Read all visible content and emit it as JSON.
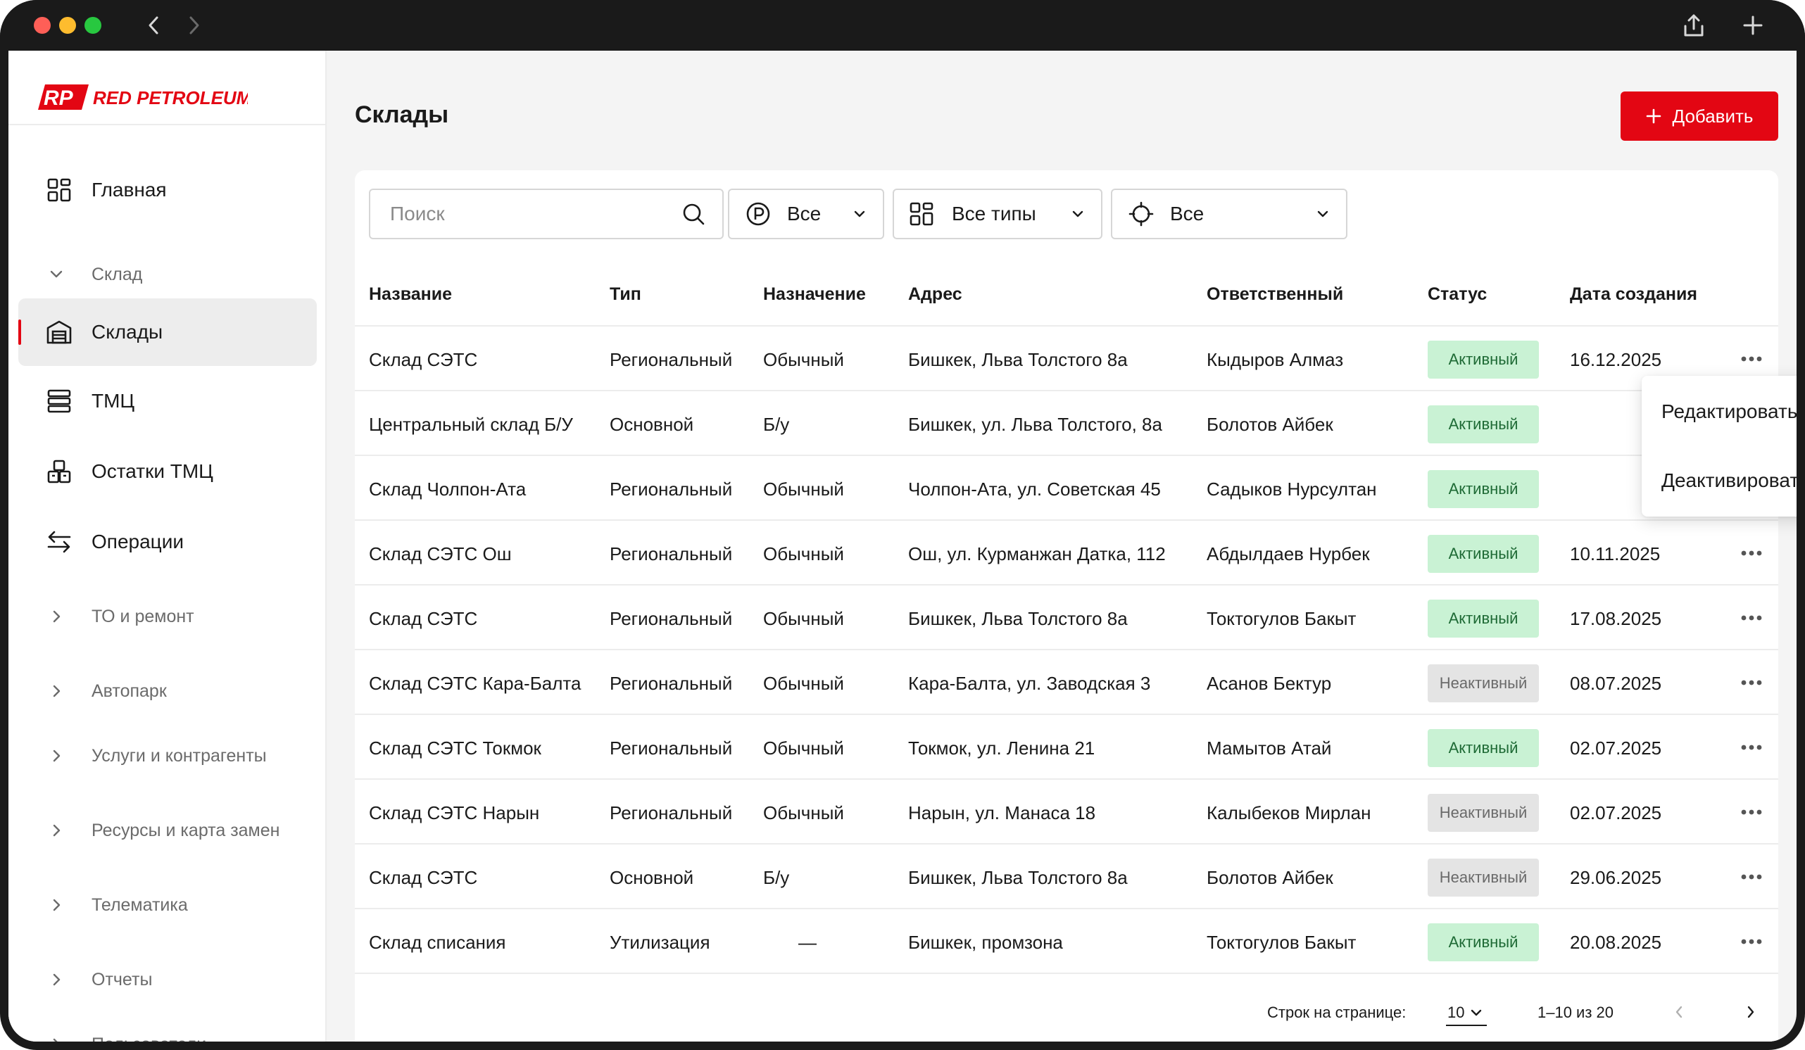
{
  "brand": {
    "logo_mark": "RP",
    "logo_text": "RED PETROLEUM",
    "accent_color": "#e30613"
  },
  "sidebar": {
    "home": "Главная",
    "warehouse_group": "Склад",
    "items": [
      {
        "label": "Склады",
        "icon": "warehouse-icon",
        "active": true
      },
      {
        "label": "ТМЦ",
        "icon": "stack-icon",
        "active": false
      },
      {
        "label": "Остатки ТМЦ",
        "icon": "boxes-icon",
        "active": false
      },
      {
        "label": "Операции",
        "icon": "swap-icon",
        "active": false
      }
    ],
    "groups": [
      "ТО и ремонт",
      "Автопарк",
      "Услуги и контрагенты",
      "Ресурсы и карта замен",
      "Телематика",
      "Отчеты",
      "Пользователи"
    ]
  },
  "header": {
    "title": "Склады",
    "add_button": "Добавить"
  },
  "filters": {
    "search_placeholder": "Поиск",
    "purpose": "Все",
    "type": "Все типы",
    "location": "Все"
  },
  "table": {
    "columns": [
      "Название",
      "Тип",
      "Назначение",
      "Адрес",
      "Ответственный",
      "Статус",
      "Дата создания"
    ],
    "rows": [
      {
        "name": "Склад СЭТС",
        "type": "Региональный",
        "purpose": "Обычный",
        "address": "Бишкек, Льва Толстого 8а",
        "owner": "Кыдыров Алмаз",
        "status": "Активный",
        "active": true,
        "date": "16.12.2025"
      },
      {
        "name": "Центральный склад Б/У",
        "type": "Основной",
        "purpose": "Б/у",
        "address": "Бишкек, ул. Льва Толстого, 8а",
        "owner": "Болотов Айбек",
        "status": "Активный",
        "active": true,
        "date": ""
      },
      {
        "name": "Склад Чолпон-Ата",
        "type": "Региональный",
        "purpose": "Обычный",
        "address": "Чолпон-Ата, ул. Советская 45",
        "owner": "Садыков Нурсултан",
        "status": "Активный",
        "active": true,
        "date": ""
      },
      {
        "name": "Склад СЭТС Ош",
        "type": "Региональный",
        "purpose": "Обычный",
        "address": "Ош, ул. Курманжан Датка, 112",
        "owner": "Абдылдаев Нурбек",
        "status": "Активный",
        "active": true,
        "date": "10.11.2025"
      },
      {
        "name": "Склад СЭТС",
        "type": "Региональный",
        "purpose": "Обычный",
        "address": "Бишкек, Льва Толстого 8а",
        "owner": "Токтогулов Бакыт",
        "status": "Активный",
        "active": true,
        "date": "17.08.2025"
      },
      {
        "name": "Склад СЭТС Кара-Балта",
        "type": "Региональный",
        "purpose": "Обычный",
        "address": "Кара-Балта, ул. Заводская 3",
        "owner": "Асанов Бектур",
        "status": "Неактивный",
        "active": false,
        "date": "08.07.2025"
      },
      {
        "name": "Склад СЭТС Токмок",
        "type": "Региональный",
        "purpose": "Обычный",
        "address": "Токмок, ул. Ленина 21",
        "owner": "Мамытов Атай",
        "status": "Активный",
        "active": true,
        "date": "02.07.2025"
      },
      {
        "name": "Склад СЭТС Нарын",
        "type": "Региональный",
        "purpose": "Обычный",
        "address": "Нарын, ул. Манаса 18",
        "owner": "Калыбеков Мирлан",
        "status": "Неактивный",
        "active": false,
        "date": "02.07.2025"
      },
      {
        "name": "Склад СЭТС",
        "type": "Основной",
        "purpose": "Б/у",
        "address": "Бишкек, Льва Толстого 8а",
        "owner": "Болотов Айбек",
        "status": "Неактивный",
        "active": false,
        "date": "29.06.2025"
      },
      {
        "name": "Склад списания",
        "type": "Утилизация",
        "purpose": "—",
        "address": "Бишкек, промзона",
        "owner": "Токтогулов Бакыт",
        "status": "Активный",
        "active": true,
        "date": "20.08.2025"
      }
    ]
  },
  "context_menu": {
    "edit": "Редактировать",
    "deactivate": "Деактивировать"
  },
  "pagination": {
    "rows_label": "Строк на странице:",
    "rows_value": "10",
    "range": "1–10 из 20"
  }
}
